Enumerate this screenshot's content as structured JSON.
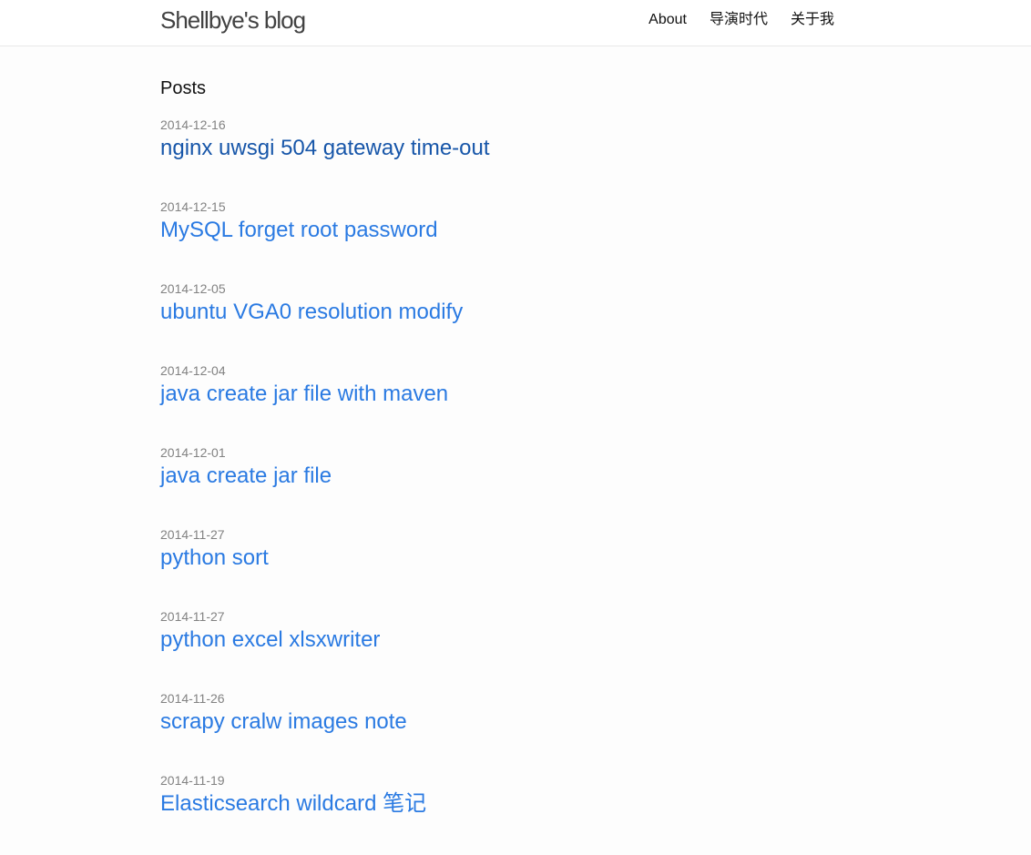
{
  "header": {
    "site_title": "Shellbye's blog",
    "nav": [
      {
        "label": "About"
      },
      {
        "label": "导演时代"
      },
      {
        "label": "关于我"
      }
    ]
  },
  "main": {
    "heading": "Posts",
    "posts": [
      {
        "date": "2014-12-16",
        "title": "nginx uwsgi 504 gateway time-out"
      },
      {
        "date": "2014-12-15",
        "title": "MySQL forget root password"
      },
      {
        "date": "2014-12-05",
        "title": "ubuntu VGA0 resolution modify"
      },
      {
        "date": "2014-12-04",
        "title": "java create jar file with maven"
      },
      {
        "date": "2014-12-01",
        "title": "java create jar file"
      },
      {
        "date": "2014-11-27",
        "title": "python sort"
      },
      {
        "date": "2014-11-27",
        "title": "python excel xlsxwriter"
      },
      {
        "date": "2014-11-26",
        "title": "scrapy cralw images note"
      },
      {
        "date": "2014-11-19",
        "title": "Elasticsearch wildcard 笔记"
      }
    ]
  },
  "colors": {
    "link": "#2a7ae2",
    "visited_link": "#1756a9",
    "meta": "#828282",
    "title": "#424242"
  }
}
